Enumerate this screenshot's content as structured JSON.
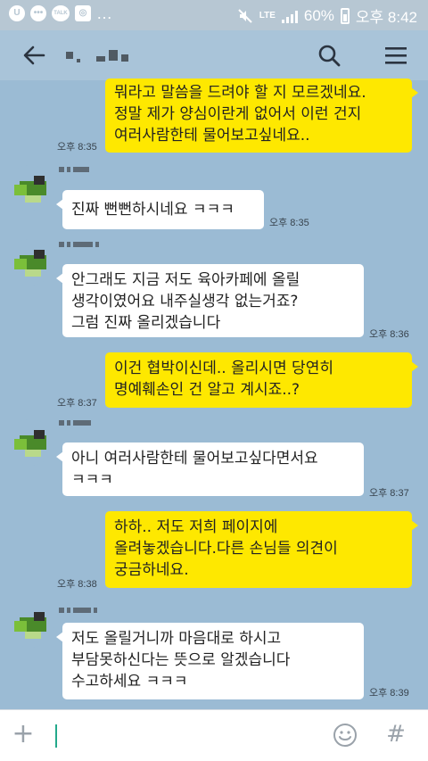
{
  "status_bar": {
    "network": "LTE",
    "battery": "60%",
    "time": "오후 8:42",
    "left_icons": [
      "circle-u-icon",
      "dots-icon",
      "kakaotalk-icon",
      "instagram-icon",
      "more-icon"
    ],
    "talk_badge": "TALK"
  },
  "header": {
    "icons": [
      "back-arrow-icon",
      "search-icon",
      "menu-icon"
    ]
  },
  "messages": [
    {
      "from": "me",
      "text": "뭐라고 말씀을 드려야 할 지 모르겠네요.\n정말 제가 양심이란게 없어서 이런 건지\n여러사람한테 물어보고싶네요..",
      "time": "오후 8:35"
    },
    {
      "from": "other",
      "text": "진짜 뻔뻔하시네요 ㅋㅋㅋ",
      "time": "오후 8:35"
    },
    {
      "from": "other",
      "text": "안그래도 지금 저도 육아카페에 올릴\n생각이였어요 내주실생각 없는거죠?\n그럼 진짜 올리겠습니다",
      "time": "오후 8:36"
    },
    {
      "from": "me",
      "text": "이건 협박이신데.. 올리시면 당연히\n명예훼손인 건 알고 계시죠..?",
      "time": "오후 8:37"
    },
    {
      "from": "other",
      "text": "아니 여러사람한테 물어보고싶다면서요\nㅋㅋㅋ",
      "time": "오후 8:37"
    },
    {
      "from": "me",
      "text": "하하.. 저도 저희 페이지에\n올려놓겠습니다.다른 손님들 의견이\n궁금하네요.",
      "time": "오후 8:38"
    },
    {
      "from": "other",
      "text": "저도 올릴거니까 마음대로 하시고\n부담못하신다는 뜻으로 알겠습니다\n수고하세요 ㅋㅋㅋ",
      "time": "오후 8:39"
    }
  ],
  "input_bar": {
    "plus_label": "+",
    "hash_label": "#",
    "placeholder": ""
  }
}
